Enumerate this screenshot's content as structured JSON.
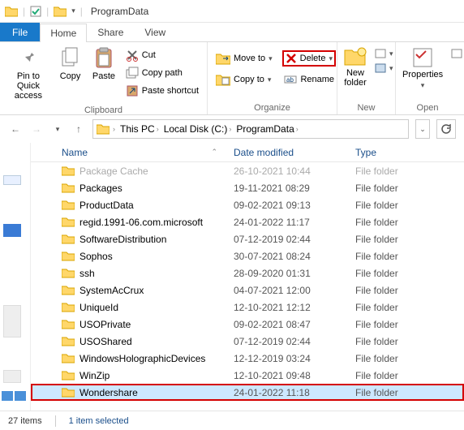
{
  "window": {
    "title": "ProgramData"
  },
  "tabs": {
    "file": "File",
    "home": "Home",
    "share": "Share",
    "view": "View"
  },
  "ribbon": {
    "clipboard": {
      "label": "Clipboard",
      "pin": "Pin to Quick\naccess",
      "copy": "Copy",
      "paste": "Paste",
      "cut": "Cut",
      "copy_path": "Copy path",
      "paste_shortcut": "Paste shortcut"
    },
    "organize": {
      "label": "Organize",
      "move_to": "Move to",
      "copy_to": "Copy to",
      "delete": "Delete",
      "rename": "Rename"
    },
    "new": {
      "label": "New",
      "new_folder": "New\nfolder"
    },
    "open": {
      "label": "Open",
      "properties": "Properties"
    }
  },
  "breadcrumbs": [
    "This PC",
    "Local Disk (C:)",
    "ProgramData"
  ],
  "columns": {
    "name": "Name",
    "date": "Date modified",
    "type": "Type"
  },
  "files": [
    {
      "name": "Package Cache",
      "date": "26-10-2021 10:44",
      "type": "File folder",
      "cutoff": true
    },
    {
      "name": "Packages",
      "date": "19-11-2021 08:29",
      "type": "File folder"
    },
    {
      "name": "ProductData",
      "date": "09-02-2021 09:13",
      "type": "File folder"
    },
    {
      "name": "regid.1991-06.com.microsoft",
      "date": "24-01-2022 11:17",
      "type": "File folder"
    },
    {
      "name": "SoftwareDistribution",
      "date": "07-12-2019 02:44",
      "type": "File folder"
    },
    {
      "name": "Sophos",
      "date": "30-07-2021 08:24",
      "type": "File folder"
    },
    {
      "name": "ssh",
      "date": "28-09-2020 01:31",
      "type": "File folder"
    },
    {
      "name": "SystemAcCrux",
      "date": "04-07-2021 12:00",
      "type": "File folder"
    },
    {
      "name": "UniqueId",
      "date": "12-10-2021 12:12",
      "type": "File folder"
    },
    {
      "name": "USOPrivate",
      "date": "09-02-2021 08:47",
      "type": "File folder"
    },
    {
      "name": "USOShared",
      "date": "07-12-2019 02:44",
      "type": "File folder"
    },
    {
      "name": "WindowsHolographicDevices",
      "date": "12-12-2019 03:24",
      "type": "File folder"
    },
    {
      "name": "WinZip",
      "date": "12-10-2021 09:48",
      "type": "File folder"
    },
    {
      "name": "Wondershare",
      "date": "24-01-2022 11:18",
      "type": "File folder",
      "selected": true,
      "highlight": true
    }
  ],
  "status": {
    "count": "27 items",
    "selection": "1 item selected"
  }
}
